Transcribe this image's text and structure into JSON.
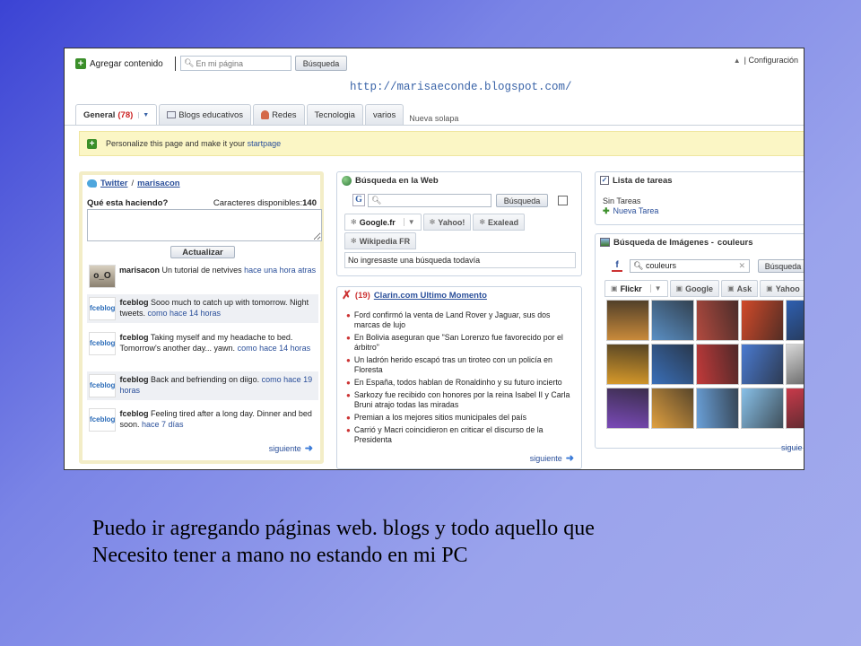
{
  "top": {
    "add_label": "Agregar contenido",
    "search_placeholder": "En mi página",
    "search_button": "Búsqueda",
    "config": "| Configuración",
    "url": "http://marisaeconde.blogspot.com/"
  },
  "tabs": [
    {
      "label": "General",
      "count": "(78)"
    },
    {
      "label": "Blogs educativos"
    },
    {
      "label": "Redes"
    },
    {
      "label": "Tecnologia"
    },
    {
      "label": "varios"
    }
  ],
  "new_tab": "Nueva solapa",
  "banner": {
    "text": "Personalize this page and make it your",
    "link": "startpage"
  },
  "twitter": {
    "title_link": "Twitter",
    "title_sep": "/",
    "title_user": "marisacon",
    "question": "Qué esta haciendo?",
    "chars_label": "Caracteres disponibles:",
    "chars_value": "140",
    "update_button": "Actualizar",
    "items": [
      {
        "avatar": "o_O",
        "user": "marisacon",
        "text": "Un tutorial de netvives",
        "time": "hace una hora atras"
      },
      {
        "avatar": "fceblog",
        "user": "fceblog",
        "text": "Sooo much to catch up with tomorrow. Night tweets.",
        "time": "como hace 14 horas"
      },
      {
        "avatar": "fceblog",
        "user": "fceblog",
        "text": "Taking myself and my headache to bed. Tomorrow's another day... yawn.",
        "time": "como hace 14 horas"
      },
      {
        "avatar": "fceblog",
        "user": "fceblog",
        "text": "Back and befriending on diigo.",
        "time": "como hace 19 horas"
      },
      {
        "avatar": "fceblog",
        "user": "fceblog",
        "text": "Feeling tired after a long day. Dinner and bed soon.",
        "time": "hace 7 días"
      }
    ],
    "siguiente": "siguiente"
  },
  "web_search": {
    "title": "Búsqueda en la Web",
    "g_icon": "G",
    "button": "Búsqueda",
    "tabs": [
      "Google.fr",
      "Yahoo!",
      "Exalead",
      "Wikipedia FR"
    ],
    "result": "No ingresaste una búsqueda todavía"
  },
  "news": {
    "count": "(19)",
    "title": "Clarin.com Ultimo Momento",
    "items": [
      "Ford confirmó la venta de Land Rover y Jaguar, sus dos marcas de lujo",
      "En Bolivia aseguran que \"San Lorenzo fue favorecido por el árbitro\"",
      "Un ladrón herido escapó tras un tiroteo con un policía en Floresta",
      "En España, todos hablan de Ronaldinho y su futuro incierto",
      "Sarkozy fue recibido con honores por la reina Isabel II y Carla Bruni atrajo todas las miradas",
      "Premian a los mejores sitios municipales del país",
      "Carrió y Macri coincidieron en criticar el discurso de la Presidenta"
    ],
    "siguiente": "siguiente"
  },
  "tasks": {
    "title": "Lista de tareas",
    "empty": "Sin Tareas",
    "new_task": "Nueva Tarea"
  },
  "images": {
    "title_prefix": "Búsqueda de Imágenes -",
    "title_query": "couleurs",
    "f_icon": "f",
    "query": "couleurs",
    "button": "Búsqueda",
    "tabs": [
      "Flickr",
      "Google",
      "Ask",
      "Yahoo"
    ],
    "siguiente": "siguie",
    "thumb_colors": [
      "#c98a3a",
      "#5a8fc4",
      "#b24a3f",
      "#d14a2a",
      "#2e5fb0",
      "#d89a2a",
      "#3a6fb8",
      "#c23a3a",
      "#4a7ad0",
      "#d8d8d8",
      "#7a4ab8",
      "#e0a040",
      "#6aa0d8",
      "#88c0e8",
      "#c83a4a"
    ]
  },
  "caption": {
    "line1": "Puedo ir agregando páginas web. blogs y todo aquello que",
    "line2": "Necesito tener a mano no estando en mi PC"
  },
  "colors": {
    "link": "#2a4f9a",
    "accent_green": "#3b8f2a",
    "banner_bg": "#fbf6c5",
    "slide_gradient_start": "#3b43d4",
    "slide_gradient_end": "#a3abed"
  }
}
